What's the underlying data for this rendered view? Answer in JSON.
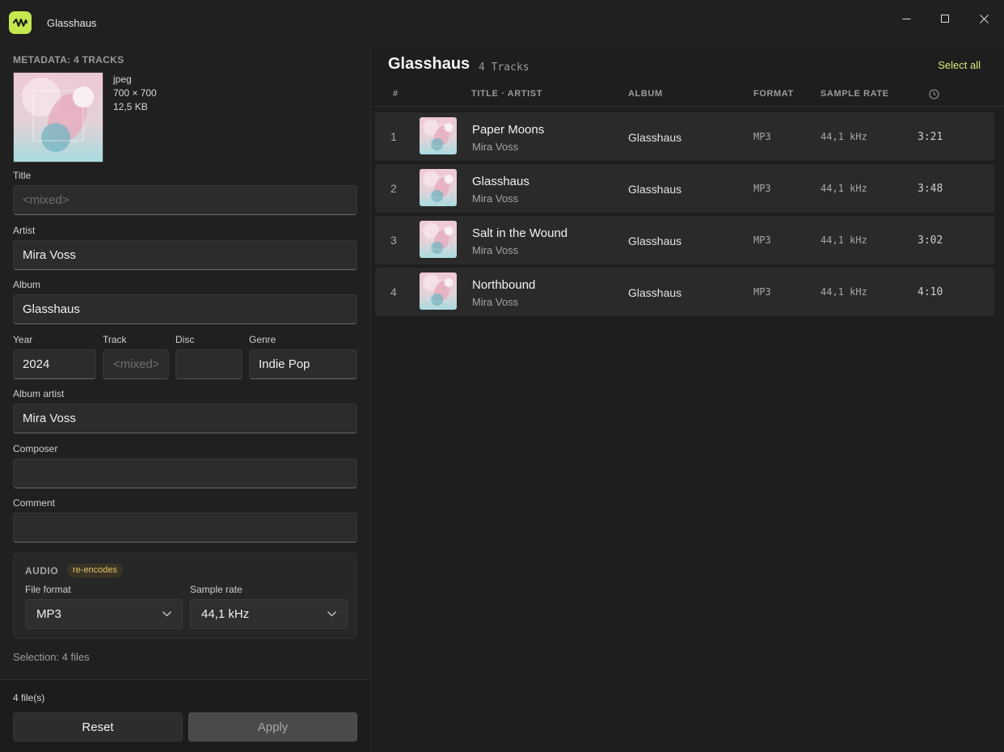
{
  "window": {
    "title": "Glasshaus"
  },
  "metadata": {
    "heading": "METADATA: 4 TRACKS",
    "cover": {
      "format": "jpeg",
      "dimensions": "700 × 700",
      "size": "12,5 KB"
    },
    "fields": {
      "title": {
        "label": "Title",
        "value": "",
        "placeholder": "<mixed>"
      },
      "artist": {
        "label": "Artist",
        "value": "Mira Voss"
      },
      "album": {
        "label": "Album",
        "value": "Glasshaus"
      },
      "year": {
        "label": "Year",
        "value": "2024"
      },
      "track": {
        "label": "Track",
        "value": "",
        "placeholder": "<mixed>"
      },
      "disc": {
        "label": "Disc",
        "value": ""
      },
      "genre": {
        "label": "Genre",
        "value": "Indie Pop"
      },
      "album_artist": {
        "label": "Album artist",
        "value": "Mira Voss"
      },
      "composer": {
        "label": "Composer",
        "value": ""
      },
      "comment": {
        "label": "Comment",
        "value": ""
      }
    },
    "audio": {
      "title": "AUDIO",
      "badge": "re-encodes",
      "file_format": {
        "label": "File format",
        "value": "MP3"
      },
      "sample_rate": {
        "label": "Sample rate",
        "value": "44,1 kHz"
      }
    },
    "selection": "Selection: 4 files",
    "file_count": "4 file(s)",
    "reset_label": "Reset",
    "apply_label": "Apply"
  },
  "tracklist": {
    "title": "Glasshaus",
    "count": "4 Tracks",
    "select_all": "Select all",
    "columns": {
      "num": "#",
      "title_artist": "TITLE · ARTIST",
      "album": "ALBUM",
      "format": "FORMAT",
      "sample_rate": "SAMPLE RATE",
      "duration_icon": "clock-icon"
    },
    "tracks": [
      {
        "num": "1",
        "title": "Paper Moons",
        "artist": "Mira Voss",
        "album": "Glasshaus",
        "format": "MP3",
        "rate": "44,1 kHz",
        "duration": "3:21"
      },
      {
        "num": "2",
        "title": "Glasshaus",
        "artist": "Mira Voss",
        "album": "Glasshaus",
        "format": "MP3",
        "rate": "44,1 kHz",
        "duration": "3:48"
      },
      {
        "num": "3",
        "title": "Salt in the Wound",
        "artist": "Mira Voss",
        "album": "Glasshaus",
        "format": "MP3",
        "rate": "44,1 kHz",
        "duration": "3:02"
      },
      {
        "num": "4",
        "title": "Northbound",
        "artist": "Mira Voss",
        "album": "Glasshaus",
        "format": "MP3",
        "rate": "44,1 kHz",
        "duration": "4:10"
      }
    ]
  },
  "colors": {
    "accent": "#c6e84f",
    "select_all": "#d6ec7a",
    "badge_text": "#e2c16a"
  }
}
